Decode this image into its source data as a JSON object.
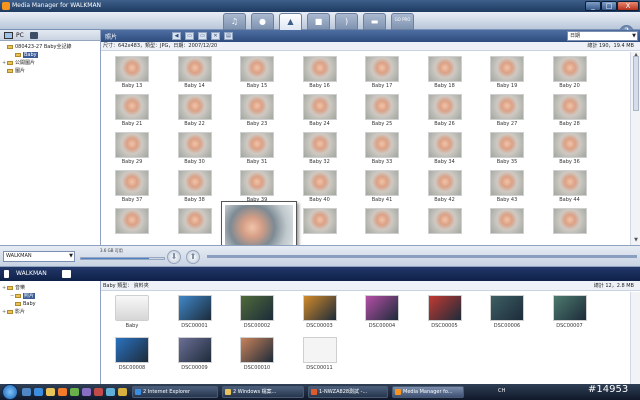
{
  "window": {
    "title": "Media Manager for WALKMAN",
    "minimize": "_",
    "maximize": "□",
    "close": "X"
  },
  "toolbar": {
    "tabs": [
      {
        "id": "music",
        "glyph": "♫",
        "active": false
      },
      {
        "id": "podcast",
        "glyph": "●",
        "active": false
      },
      {
        "id": "photo",
        "glyph": "▲",
        "active": true
      },
      {
        "id": "video",
        "glyph": "■",
        "active": false
      },
      {
        "id": "rss",
        "glyph": ")",
        "active": false
      },
      {
        "id": "tools",
        "glyph": "▬",
        "active": false
      },
      {
        "id": "gopro",
        "glyph": "GO PRO",
        "active": false
      }
    ],
    "help": "?"
  },
  "pc_pane": {
    "label": "PC",
    "tree": [
      {
        "label": "080423-27 Baby全記錄",
        "expander": "",
        "selected": false
      },
      {
        "label": "Baby",
        "expander": "",
        "selected": true
      },
      {
        "label": "公開圖片",
        "expander": "+",
        "selected": false
      },
      {
        "label": "圖片",
        "expander": "",
        "selected": false
      }
    ]
  },
  "pc_main": {
    "breadcrumb": "照片",
    "sort_value": "日期",
    "info": "尺寸：642x483，類型：JPG，日期：2007/12/20",
    "total": "總計 190，19.4 MB",
    "thumbnails": [
      "Baby 13",
      "Baby 14",
      "Baby 15",
      "Baby 16",
      "Baby 17",
      "Baby 18",
      "Baby 19",
      "Baby 20",
      "Baby 21",
      "Baby 22",
      "Baby 23",
      "Baby 24",
      "Baby 25",
      "Baby 26",
      "Baby 27",
      "Baby 28",
      "Baby 29",
      "Baby 30",
      "Baby 31",
      "Baby 32",
      "Baby 33",
      "Baby 34",
      "Baby 35",
      "Baby 36",
      "Baby 37",
      "Baby 38",
      "Baby 39",
      "Baby 40",
      "Baby 41",
      "Baby 42",
      "Baby 43",
      "Baby 44",
      "",
      "",
      "",
      "",
      "",
      "",
      "",
      ""
    ]
  },
  "transfer": {
    "device": "WALKMAN",
    "capacity": "3.6 GB 可用",
    "capacity_used_fraction": 0.82,
    "down_glyph": "⬇",
    "up_glyph": "⬆"
  },
  "walkman_pane": {
    "label": "WALKMAN",
    "tree": [
      {
        "label": "音樂",
        "expander": "+",
        "selected": false
      },
      {
        "label": "照片",
        "expander": "−",
        "selected": true
      },
      {
        "label": "Baby",
        "expander": "",
        "selected": false
      },
      {
        "label": "影片",
        "expander": "+",
        "selected": false
      }
    ]
  },
  "walkman_main": {
    "info_left": "Baby  類型： 資料夾",
    "total": "總計 12，2.8 MB",
    "items": [
      {
        "label": "Baby",
        "kind": "folder",
        "color": "#e2e2e2"
      },
      {
        "label": "DSC00001",
        "kind": "photo",
        "color": "#3f88c9"
      },
      {
        "label": "DSC00002",
        "kind": "photo",
        "color": "#4f6b3a"
      },
      {
        "label": "DSC00003",
        "kind": "photo",
        "color": "#d08a2a"
      },
      {
        "label": "DSC00004",
        "kind": "photo",
        "color": "#b44fa6"
      },
      {
        "label": "DSC00005",
        "kind": "photo",
        "color": "#c23a32"
      },
      {
        "label": "DSC00006",
        "kind": "photo",
        "color": "#3d5f63"
      },
      {
        "label": "DSC00007",
        "kind": "photo",
        "color": "#4c7a6d"
      },
      {
        "label": "DSC00008",
        "kind": "photo",
        "color": "#2a72c0"
      },
      {
        "label": "DSC00009",
        "kind": "photo",
        "color": "#6c6f96"
      },
      {
        "label": "DSC00010",
        "kind": "photo",
        "color": "#c9825a"
      },
      {
        "label": "DSC00011",
        "kind": "photo",
        "color": "#f4f4f4"
      }
    ]
  },
  "taskbar": {
    "tasks": [
      {
        "label": "2 Internet Explorer",
        "active": false,
        "color": "#3b8de0"
      },
      {
        "label": "2 Windows 檔案...",
        "active": false,
        "color": "#e7c35a"
      },
      {
        "label": "1-NWZA828測試 -...",
        "active": false,
        "color": "#e05a2a"
      },
      {
        "label": "Media Manager fo...",
        "active": true,
        "color": "#f7941d"
      }
    ],
    "tray": "CH",
    "watermark": "#14953"
  }
}
